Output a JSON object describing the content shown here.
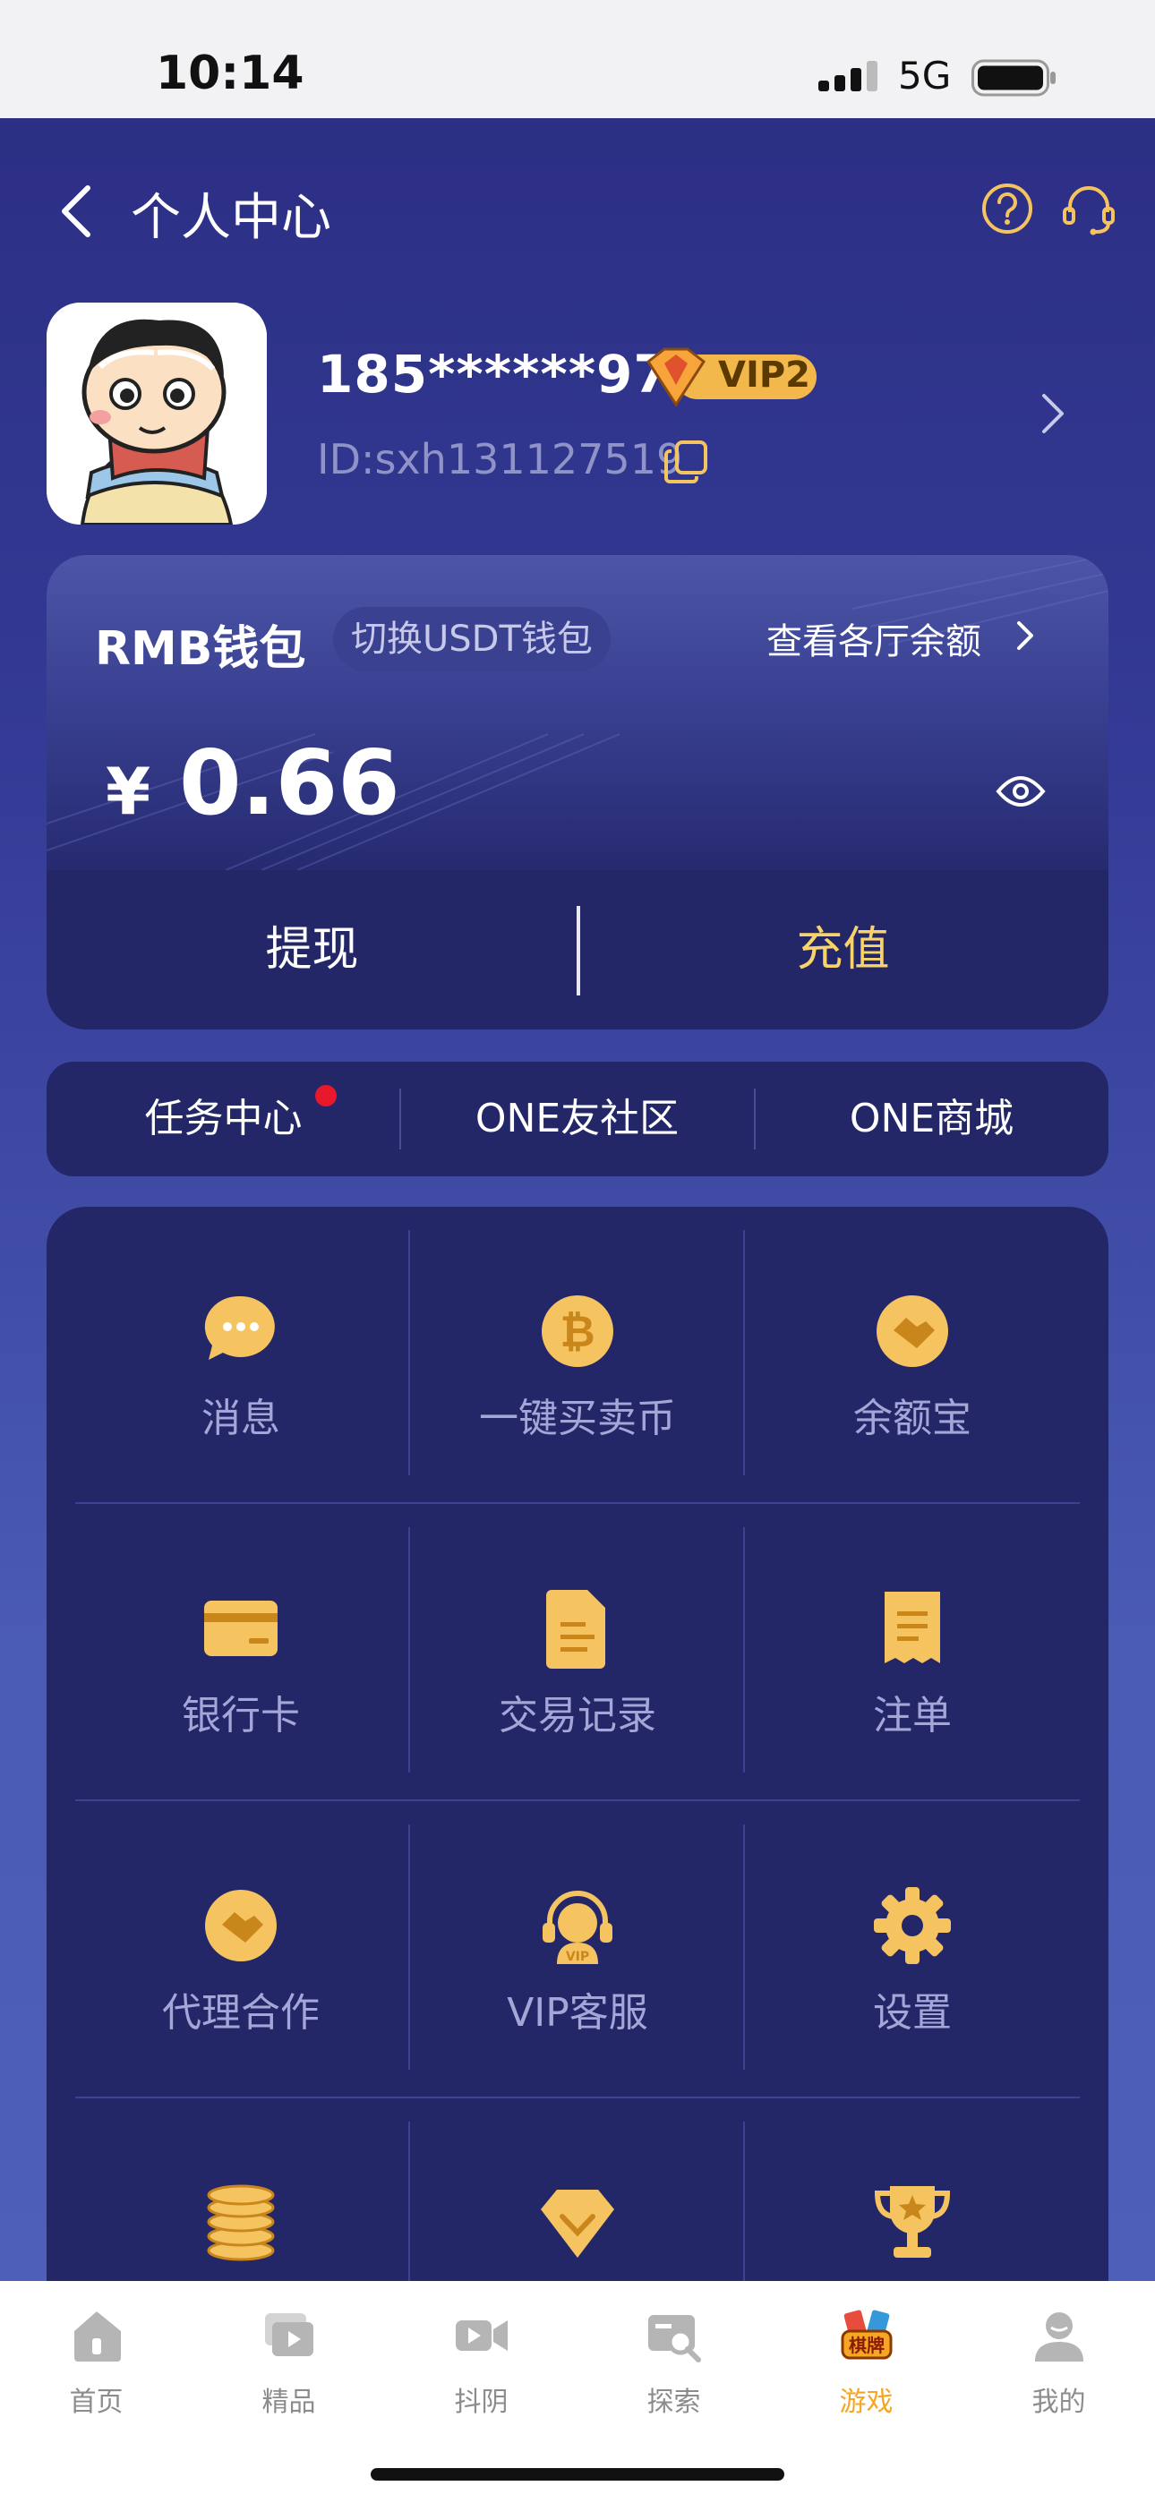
{
  "status": {
    "time": "10:14",
    "network": "5G"
  },
  "nav": {
    "title": "个人中心"
  },
  "profile": {
    "username": "185******97",
    "vip": "VIP2",
    "id": "ID:sxh131127519"
  },
  "wallet": {
    "title": "RMB钱包",
    "switch_label": "切换USDT钱包",
    "check_label": "查看各厅余额",
    "currency": "¥",
    "amount": "0.66",
    "withdraw_label": "提现",
    "recharge_label": "充值"
  },
  "quick_links": [
    "任务中心",
    "ONE友社区",
    "ONE商城"
  ],
  "grid": [
    {
      "label": "消息",
      "icon": "chat-bubble-icon"
    },
    {
      "label": "一键买卖币",
      "icon": "bitcoin-icon"
    },
    {
      "label": "余额宝",
      "icon": "handshake-coin-icon"
    },
    {
      "label": "银行卡",
      "icon": "bank-card-icon"
    },
    {
      "label": "交易记录",
      "icon": "document-icon"
    },
    {
      "label": "注单",
      "icon": "receipt-icon"
    },
    {
      "label": "代理合作",
      "icon": "handshake-coin-icon"
    },
    {
      "label": "VIP客服",
      "icon": "vip-headset-icon"
    },
    {
      "label": "设置",
      "icon": "gear-icon"
    },
    {
      "label": "",
      "icon": "coin-stack-icon"
    },
    {
      "label": "",
      "icon": "diamond-icon"
    },
    {
      "label": "",
      "icon": "trophy-icon"
    }
  ],
  "tabs": [
    {
      "label": "首页",
      "icon": "home-icon"
    },
    {
      "label": "精品",
      "icon": "video-stack-icon"
    },
    {
      "label": "抖阴",
      "icon": "video-camera-icon"
    },
    {
      "label": "探索",
      "icon": "explore-icon"
    },
    {
      "label": "游戏",
      "icon": "chess-cards-icon",
      "active": true
    },
    {
      "label": "我的",
      "icon": "user-icon"
    }
  ],
  "colors": {
    "accent_gold": "#f8d36a",
    "active_tab": "#f5a623",
    "background": "#2c2f84"
  }
}
